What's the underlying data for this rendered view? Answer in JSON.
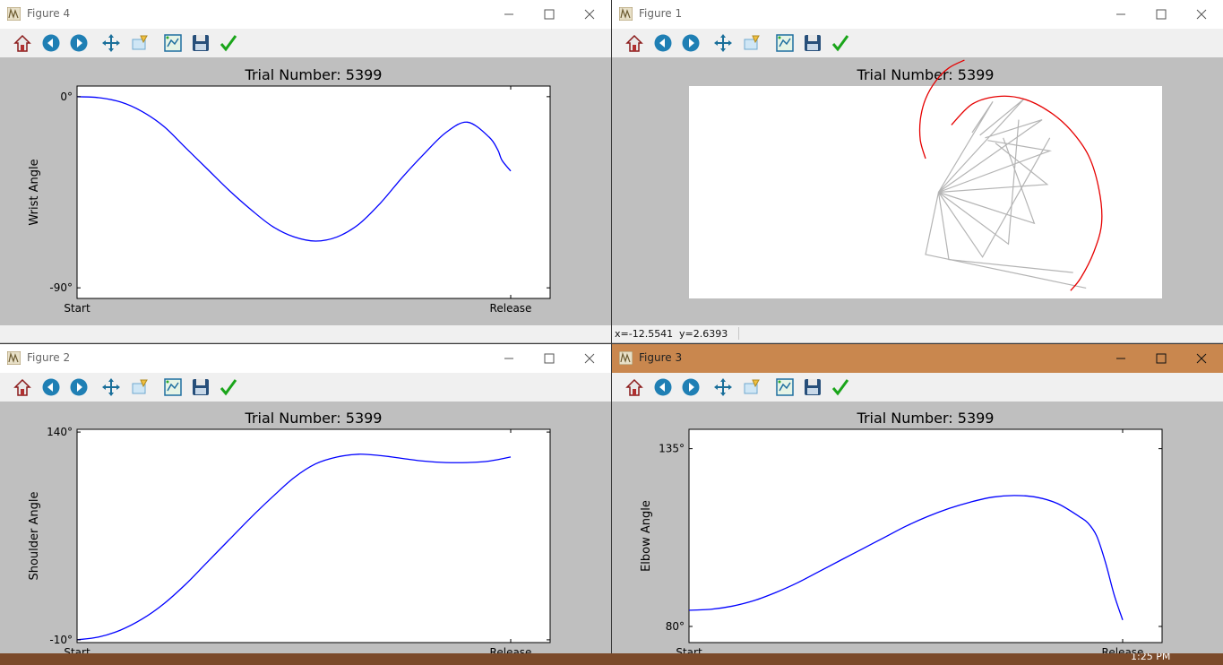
{
  "toolbar_icons": [
    "home-icon",
    "back-arrow-icon",
    "forward-arrow-icon",
    "pan-icon",
    "zoom-icon",
    "configure-subplots-icon",
    "save-icon",
    "edit-axes-icon"
  ],
  "windows": {
    "fig4": {
      "title": "Figure 4",
      "active": false,
      "chart_data": {
        "type": "line",
        "title": "Trial Number: 5399",
        "xlabel": "",
        "ylabel": "Wrist Angle",
        "xticks": [
          "Start",
          "Release"
        ],
        "yticks": [
          "0°",
          "-90°"
        ],
        "ylim": [
          -95,
          5
        ],
        "grid": false,
        "series": [
          {
            "color": "#0000ff",
            "x": [
              0,
              5,
              10,
              15,
              20,
              25,
              30,
              35,
              40,
              45,
              50,
              55,
              60,
              65,
              70,
              75,
              80,
              85,
              90,
              95,
              97,
              98,
              100
            ],
            "y": [
              0,
              -0.5,
              -2.5,
              -7,
              -14,
              -24,
              -34,
              -44,
              -53,
              -61,
              -66,
              -68,
              -66,
              -60,
              -50,
              -38,
              -27,
              -17,
              -12,
              -19,
              -25,
              -30,
              -35
            ]
          }
        ]
      }
    },
    "fig1": {
      "title": "Figure 1",
      "active": false,
      "status_x": "x=-12.5541",
      "status_y": "y=2.6393",
      "chart_data": {
        "type": "line",
        "title": "Trial Number: 5399",
        "xlabel": "",
        "ylabel": "",
        "grid": false,
        "axes_visible": false,
        "xlim": [
          -12,
          6
        ],
        "ylim": [
          -5.4,
          2.8
        ],
        "base_point": [
          -2.5,
          -1.3
        ],
        "arm_color": "#b4b4b4",
        "path_color": "#e60000",
        "arm_poses": [
          {
            "elbow": [
              -0.4,
              2.2
            ],
            "wrist": [
              -1.2,
              1.0
            ]
          },
          {
            "elbow": [
              0.8,
              2.3
            ],
            "wrist": [
              -0.9,
              0.9
            ]
          },
          {
            "elbow": [
              1.5,
              1.5
            ],
            "wrist": [
              -0.7,
              0.8
            ]
          },
          {
            "elbow": [
              1.8,
              0.3
            ],
            "wrist": [
              -0.6,
              0.7
            ]
          },
          {
            "elbow": [
              1.7,
              -1.0
            ],
            "wrist": [
              -0.3,
              0.6
            ]
          },
          {
            "elbow": [
              1.2,
              -2.5
            ],
            "wrist": [
              0.0,
              0.8
            ]
          },
          {
            "elbow": [
              0.2,
              -3.3
            ],
            "wrist": [
              0.6,
              1.5
            ]
          },
          {
            "elbow": [
              -0.8,
              -3.8
            ],
            "wrist": [
              1.8,
              0.8
            ]
          },
          {
            "elbow": [
              -2.1,
              -3.9
            ],
            "wrist": [
              2.7,
              -4.4
            ]
          },
          {
            "elbow": [
              -3.0,
              -3.7
            ],
            "wrist": [
              3.2,
              -5.0
            ]
          }
        ],
        "upper_path": [
          [
            -1.5,
            3.8
          ],
          [
            -2.1,
            3.5
          ],
          [
            -2.6,
            3.0
          ],
          [
            -3.0,
            2.3
          ],
          [
            -3.2,
            1.5
          ],
          [
            -3.2,
            0.7
          ],
          [
            -3.0,
            0.0
          ]
        ],
        "lower_path": [
          [
            -2.0,
            1.3
          ],
          [
            -1.2,
            2.1
          ],
          [
            -0.2,
            2.4
          ],
          [
            0.8,
            2.3
          ],
          [
            1.8,
            1.8
          ],
          [
            2.6,
            1.1
          ],
          [
            3.3,
            0.1
          ],
          [
            3.7,
            -1.2
          ],
          [
            3.8,
            -2.5
          ],
          [
            3.5,
            -3.6
          ],
          [
            3.0,
            -4.6
          ],
          [
            2.6,
            -5.1
          ]
        ]
      }
    },
    "fig2": {
      "title": "Figure 2",
      "active": false,
      "chart_data": {
        "type": "line",
        "title": "Trial Number: 5399",
        "xlabel": "",
        "ylabel": "Shoulder Angle",
        "xticks": [
          "Start",
          "Release"
        ],
        "yticks": [
          "140°",
          "-10°"
        ],
        "ylim": [
          -12,
          142
        ],
        "grid": false,
        "series": [
          {
            "color": "#0000ff",
            "x": [
              0,
              5,
              10,
              15,
              20,
              25,
              30,
              35,
              40,
              45,
              50,
              55,
              60,
              65,
              70,
              75,
              80,
              85,
              90,
              95,
              100
            ],
            "y": [
              -10,
              -8,
              -3,
              5,
              16,
              30,
              46,
              62,
              78,
              93,
              107,
              117,
              122,
              124,
              123,
              121,
              119,
              118,
              118,
              119,
              122
            ]
          }
        ]
      }
    },
    "fig3": {
      "title": "Figure 3",
      "active": true,
      "chart_data": {
        "type": "line",
        "title": "Trial Number: 5399",
        "xlabel": "",
        "ylabel": "Elbow Angle",
        "xticks": [
          "Start",
          "Release"
        ],
        "yticks": [
          "135°",
          "80°"
        ],
        "ylim": [
          75,
          141
        ],
        "grid": false,
        "series": [
          {
            "color": "#0000ff",
            "x": [
              0,
              5,
              10,
              15,
              20,
              25,
              30,
              35,
              40,
              45,
              50,
              55,
              60,
              65,
              70,
              75,
              80,
              85,
              90,
              92,
              94,
              96,
              98,
              100
            ],
            "y": [
              85,
              85.3,
              86.3,
              88,
              90.5,
              93.5,
              97,
              100.5,
              104,
              107.5,
              111,
              114,
              116.5,
              118.5,
              120,
              120.5,
              120,
              118,
              114,
              112,
              108,
              100,
              90,
              82
            ]
          }
        ]
      }
    }
  },
  "taskbar": {
    "clock": "1:25 PM"
  }
}
